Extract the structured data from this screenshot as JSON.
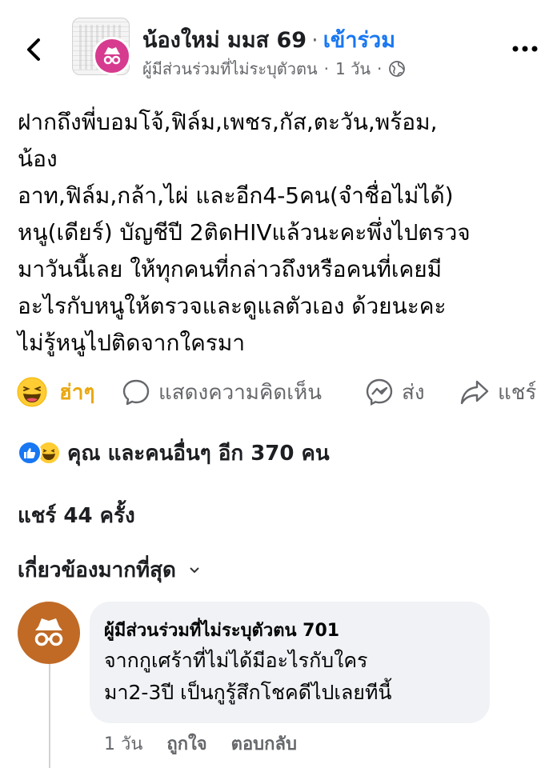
{
  "header": {
    "group_name": "น้องใหม่ มมส 69",
    "separator": "·",
    "join_label": "เข้าร่วม",
    "author": "ผู้มีส่วนร่วมที่ไม่ระบุตัวตน",
    "time": "1 วัน",
    "back_icon": "chevron-left-icon",
    "more_icon": "more-dots-icon",
    "privacy_icon": "globe-icon"
  },
  "post": {
    "lines": [
      "ฝากถึงพี่บอมโจ้,ฟิล์ม,เพชร,กัส,ตะวัน,พร้อม,",
      "น้อง",
      "อาท,ฟิล์ม,กล้า,ไผ่ และอีก4-5คน(จำชื่อไม่ได้)",
      "หนู(เดียร์) บัญชีปี 2ติดHIVแล้วนะคะพึ่งไปตรวจ",
      "มาวันนี้เลย ให้ทุกคนที่กล่าวถึงหรือคนที่เคยมี",
      "อะไรกับหนูให้ตรวจและดูแลตัวเอง ด้วยนะคะ",
      "ไม่รู้หนูไปติดจากใครมา"
    ]
  },
  "actions": {
    "reaction_label": "ฮ่าๆ",
    "comment_label": "แสดงความคิดเห็น",
    "send_label": "ส่ง",
    "share_label": "แชร์"
  },
  "reactions_summary": "คุณ และคนอื่นๆ อีก 370 คน",
  "share_count": "แชร์ 44 ครั้ง",
  "sort_label": "เกี่ยวข้องมากที่สุด",
  "comment": {
    "author": "ผู้มีส่วนร่วมที่ไม่ระบุตัวตน 701",
    "lines": [
      "จากกูเศร้าที่ไม่ได้มีอะไรกับใคร",
      "มา2-3ปี เป็นกูรู้สึกโชคดีไปเลยทีนี้"
    ],
    "time": "1 วัน",
    "like_label": "ถูกใจ",
    "reply_label": "ตอบกลับ"
  },
  "colors": {
    "accent": "#1877f2",
    "haha": "#e9a810",
    "anon_badge": "#d63b8f",
    "comment_avatar": "#c06a26",
    "bubble_bg": "#f0f2f5"
  }
}
